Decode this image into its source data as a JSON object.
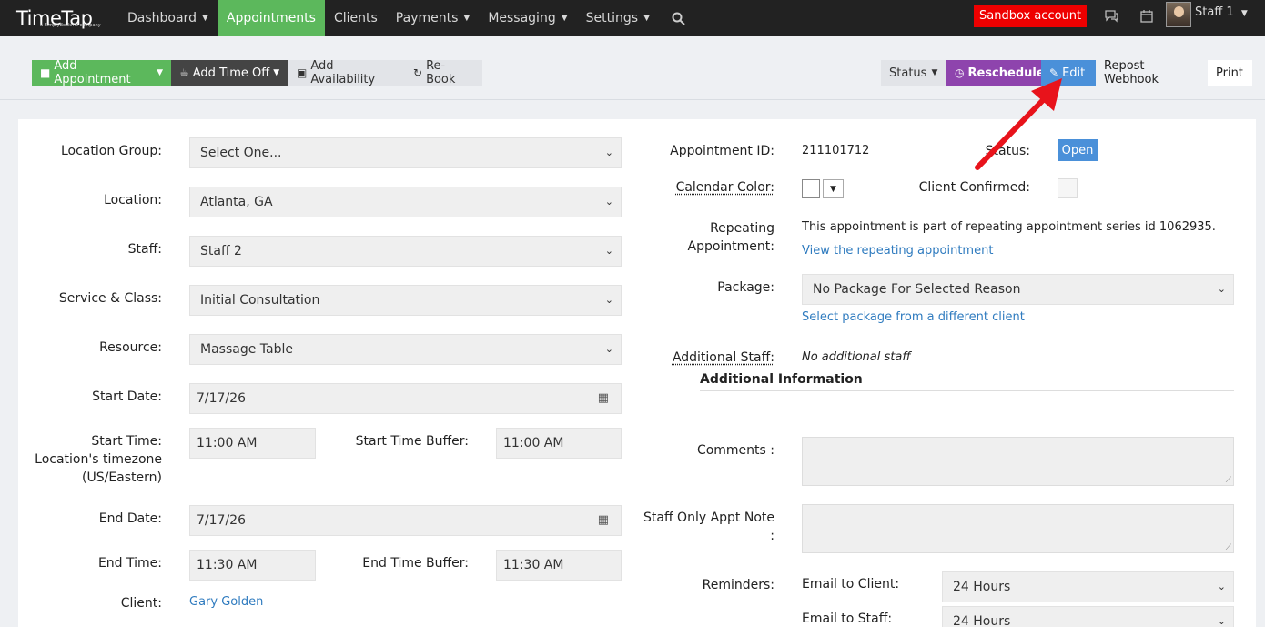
{
  "nav": {
    "logo_text": "TimeTap",
    "logo_sub": "a SimplyBookme company",
    "items": [
      {
        "label": "Dashboard",
        "caret": true
      },
      {
        "label": "Appointments",
        "caret": false
      },
      {
        "label": "Clients",
        "caret": false
      },
      {
        "label": "Payments",
        "caret": true
      },
      {
        "label": "Messaging",
        "caret": true
      },
      {
        "label": "Settings",
        "caret": true
      }
    ],
    "sandbox": "Sandbox account",
    "user": "Staff 1"
  },
  "toolbar": {
    "add_appointment": "Add Appointment",
    "add_time_off": "Add Time Off",
    "add_availability": "Add Availability",
    "rebook": "Re-Book",
    "status": "Status",
    "reschedule": "Reschedule",
    "edit": "Edit",
    "repost_webhook": "Repost Webhook",
    "print": "Print"
  },
  "colors": {
    "nav_bg": "#222222",
    "active": "#5cb85c",
    "sandbox": "#ee0000",
    "reschedule": "#8e44ad",
    "edit": "#4a90d9",
    "link": "#2f7bbf",
    "arrow": "#e8131b"
  },
  "form_left": {
    "location_group_label": "Location Group:",
    "location_group_value": "Select One...",
    "location_label": "Location:",
    "location_value": "Atlanta, GA",
    "staff_label": "Staff:",
    "staff_value": "Staff 2",
    "service_label": "Service & Class:",
    "service_value": "Initial Consultation",
    "resource_label": "Resource:",
    "resource_value": "Massage Table",
    "start_date_label": "Start Date:",
    "start_date_value": "7/17/26",
    "start_time_label_1": "Start Time:",
    "start_time_label_2": "Location's timezone",
    "start_time_label_3": "(US/Eastern)",
    "start_time_value": "11:00 AM",
    "start_buffer_label": "Start Time Buffer:",
    "start_buffer_value": "11:00 AM",
    "end_date_label": "End Date:",
    "end_date_value": "7/17/26",
    "end_time_label": "End Time:",
    "end_time_value": "11:30 AM",
    "end_buffer_label": "End Time Buffer:",
    "end_buffer_value": "11:30 AM",
    "client_label": "Client:",
    "client_value": "Gary Golden"
  },
  "form_right": {
    "appt_id_label": "Appointment ID:",
    "appt_id_value": "211101712",
    "status_label": "Status:",
    "status_value": "Open",
    "calendar_color_label": "Calendar Color:",
    "client_confirmed_label": "Client Confirmed:",
    "repeating_label_1": "Repeating",
    "repeating_label_2": "Appointment:",
    "repeating_text": "This appointment is part of repeating appointment series id 1062935.",
    "repeating_link": "View the repeating appointment",
    "package_label": "Package:",
    "package_value": "No Package For Selected Reason",
    "package_link": "Select package from a different client",
    "additional_staff_label": "Additional Staff:",
    "additional_staff_value": "No additional staff",
    "additional_info_title": "Additional Information",
    "comments_label": "Comments :",
    "staff_note_label_1": "Staff Only Appt Note",
    "staff_note_label_2": ":",
    "reminders_label": "Reminders:",
    "email_client_label": "Email to Client:",
    "email_client_value": "24 Hours",
    "email_staff_label": "Email to Staff:",
    "email_staff_value": "24 Hours"
  }
}
